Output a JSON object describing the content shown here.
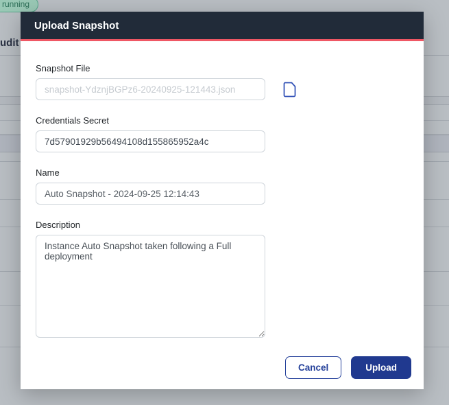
{
  "background": {
    "status_badge_label": "running",
    "partial_heading": "udit L"
  },
  "modal": {
    "title": "Upload Snapshot",
    "snapshot_file": {
      "label": "Snapshot File",
      "placeholder": "snapshot-YdznjBGPz6-20240925-121443.json",
      "icon": "file-icon"
    },
    "credentials_secret": {
      "label": "Credentials Secret",
      "value": "7d57901929b56494108d155865952a4c"
    },
    "name": {
      "label": "Name",
      "value": "Auto Snapshot - 2024-09-25 12:14:43"
    },
    "description": {
      "label": "Description",
      "value": "Instance Auto Snapshot taken following a Full deployment"
    },
    "footer": {
      "cancel_label": "Cancel",
      "upload_label": "Upload"
    }
  },
  "colors": {
    "header_bg": "#212b39",
    "accent_red": "#ef5764",
    "primary_blue": "#20398f",
    "icon_blue": "#2d4db5",
    "badge_bg": "#9ac9b6",
    "badge_border": "#55a489",
    "badge_text": "#2c6e57",
    "page_bg": "#b9bec3"
  }
}
